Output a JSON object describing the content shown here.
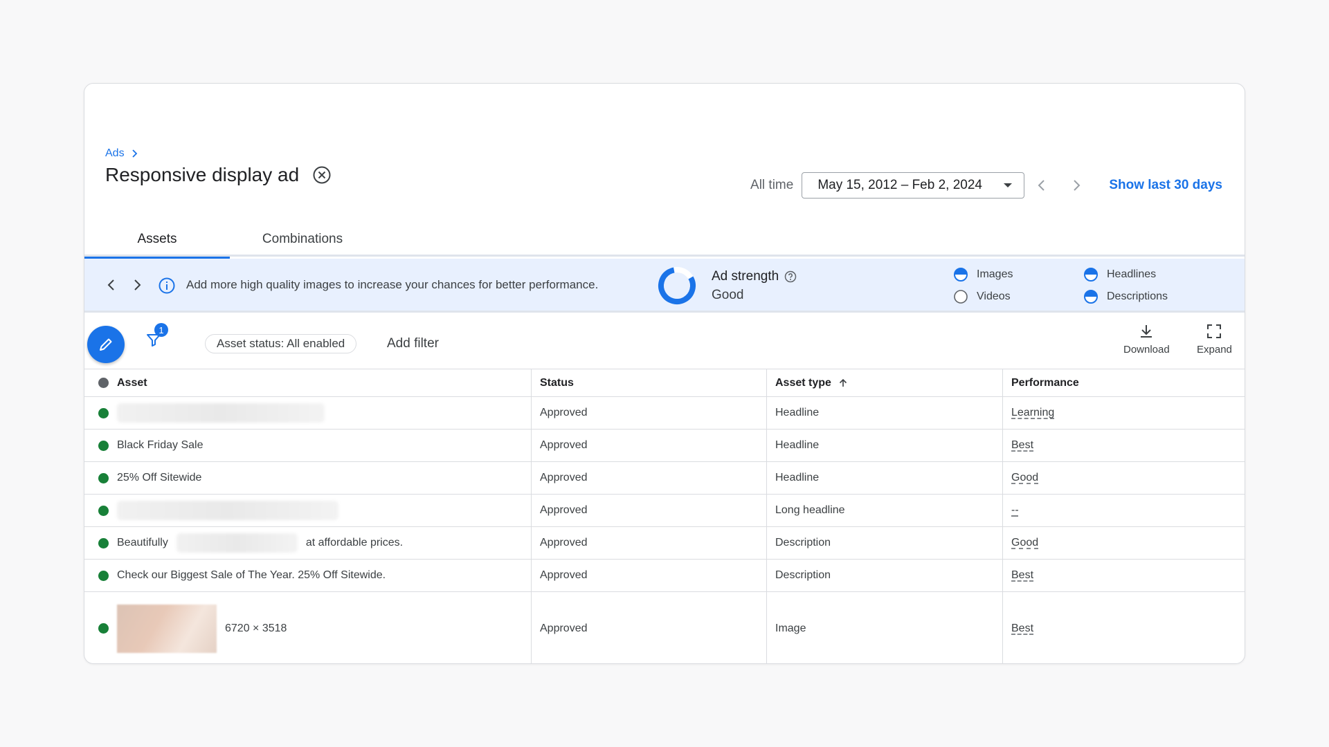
{
  "breadcrumb": {
    "root": "Ads"
  },
  "page": {
    "title": "Responsive display ad"
  },
  "date_range": {
    "prefix": "All time",
    "value": "May 15, 2012 – Feb 2, 2024",
    "show_last": "Show last 30 days"
  },
  "tabs": [
    {
      "label": "Assets",
      "active": true
    },
    {
      "label": "Combinations",
      "active": false
    }
  ],
  "banner": {
    "message": "Add more high quality images to increase your chances for better performance.",
    "ad_strength_label": "Ad strength",
    "ad_strength_value": "Good",
    "legend": [
      {
        "label": "Images",
        "state": "half"
      },
      {
        "label": "Headlines",
        "state": "half"
      },
      {
        "label": "Videos",
        "state": "empty"
      },
      {
        "label": "Descriptions",
        "state": "half"
      }
    ]
  },
  "toolbar": {
    "filter_count": "1",
    "asset_status_chip": "Asset status: All enabled",
    "add_filter": "Add filter",
    "download": "Download",
    "expand": "Expand"
  },
  "table": {
    "headers": {
      "asset": "Asset",
      "status": "Status",
      "asset_type": "Asset type",
      "performance": "Performance"
    },
    "rows": [
      {
        "asset": "",
        "status": "Approved",
        "type": "Headline",
        "performance": "Learning"
      },
      {
        "asset": "Black Friday Sale",
        "status": "Approved",
        "type": "Headline",
        "performance": "Best"
      },
      {
        "asset": "25% Off Sitewide",
        "status": "Approved",
        "type": "Headline",
        "performance": "Good"
      },
      {
        "asset": "",
        "status": "Approved",
        "type": "Long headline",
        "performance": "--"
      },
      {
        "asset_prefix": "Beautifully",
        "asset_suffix": "at affordable prices.",
        "status": "Approved",
        "type": "Description",
        "performance": "Good"
      },
      {
        "asset": "Check our Biggest Sale of The Year. 25% Off Sitewide.",
        "status": "Approved",
        "type": "Description",
        "performance": "Best"
      },
      {
        "asset": "6720 × 3518",
        "status": "Approved",
        "type": "Image",
        "performance": "Best"
      }
    ]
  },
  "colors": {
    "accent": "#1a73e8",
    "status_green": "#188038",
    "banner_bg": "#e8f0fe"
  }
}
